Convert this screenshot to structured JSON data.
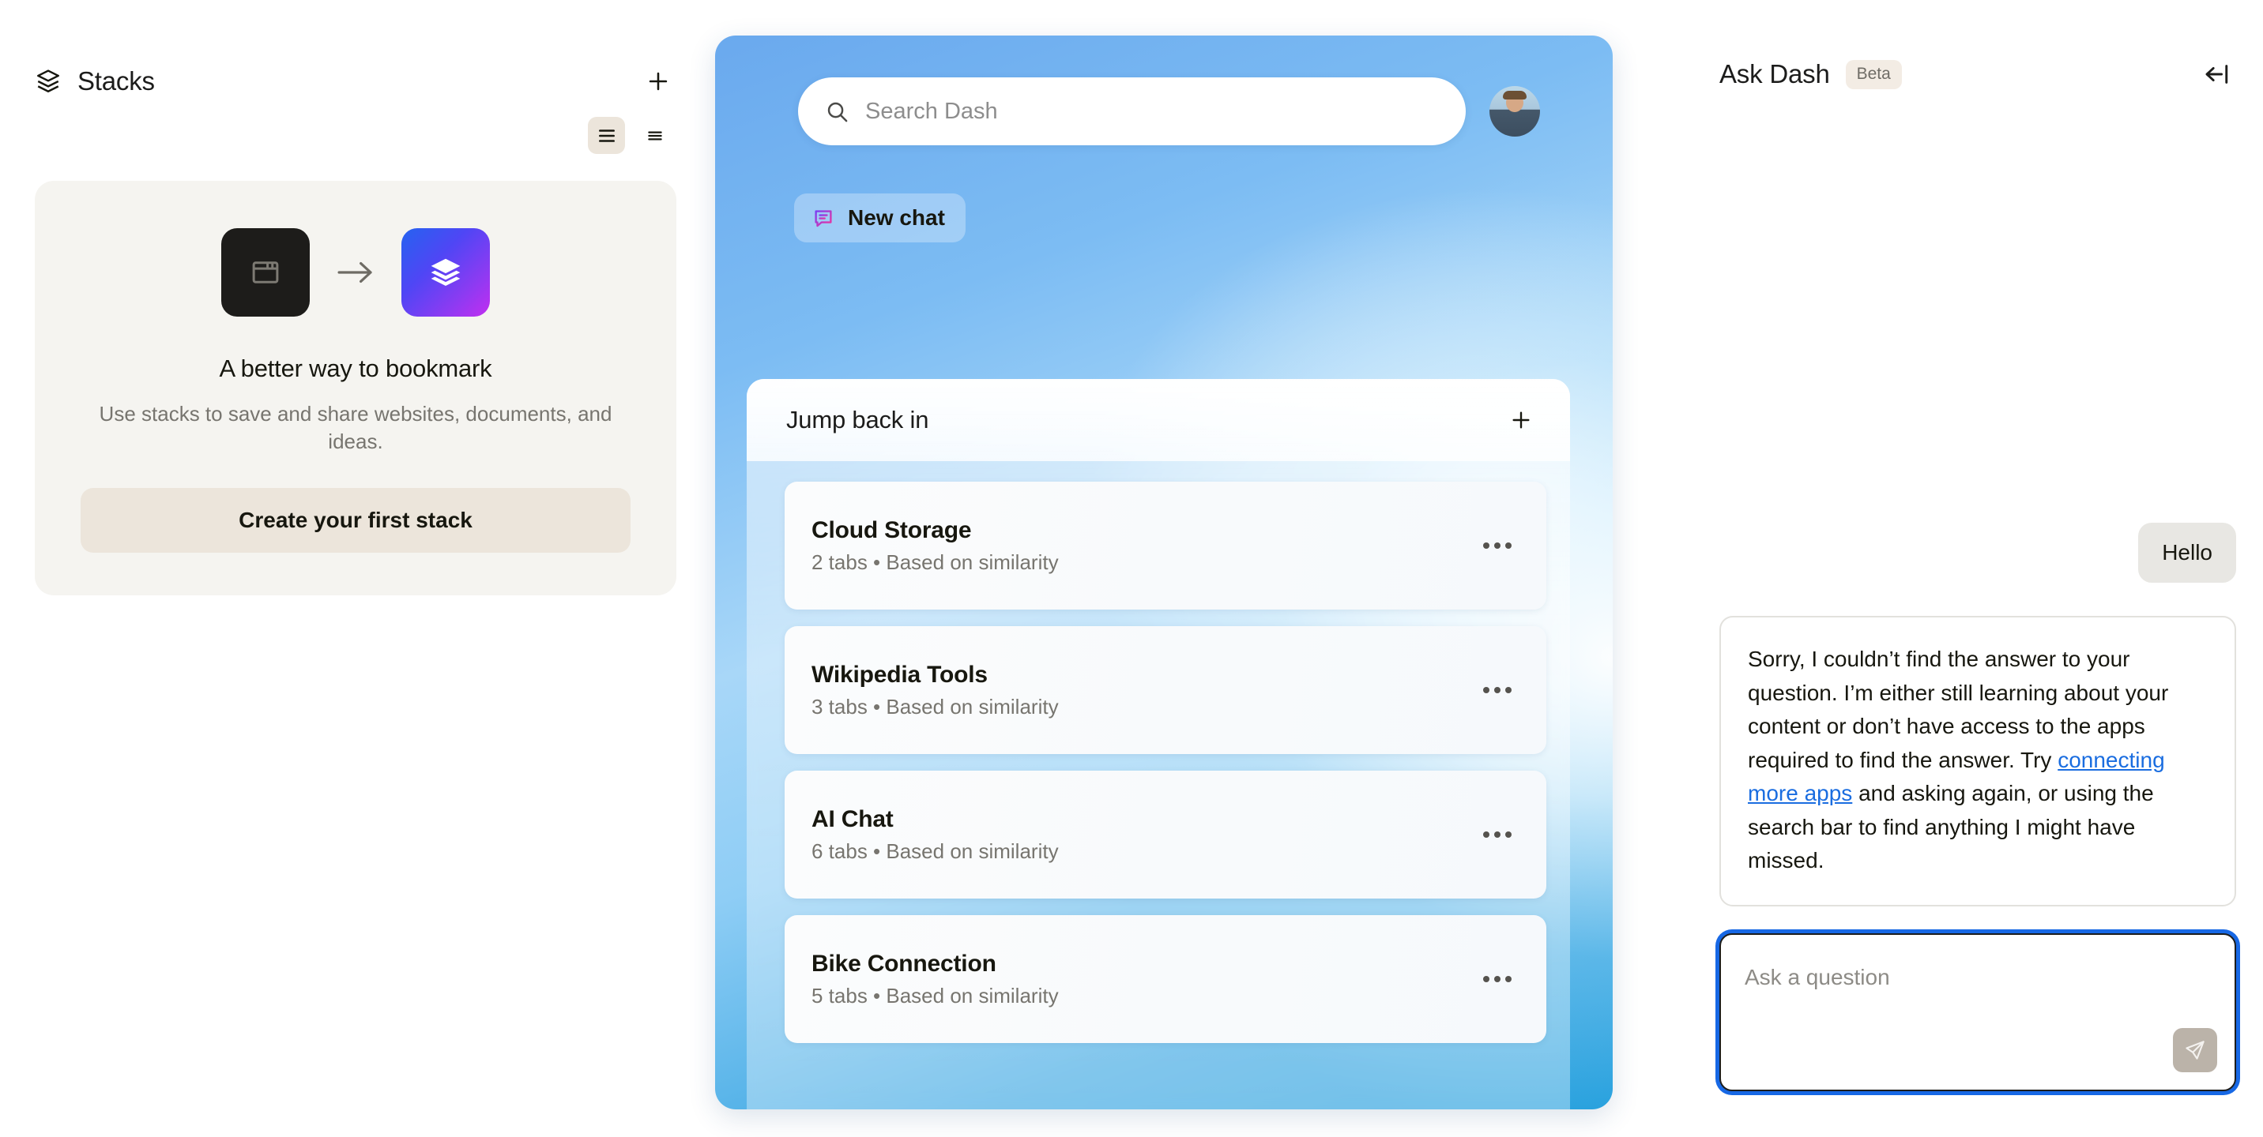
{
  "stacks": {
    "title": "Stacks",
    "icon": "layers-icon",
    "add_label": "+",
    "view_toggles": [
      {
        "name": "comfortable-view",
        "icon": "list-comfortable-icon",
        "active": true
      },
      {
        "name": "compact-view",
        "icon": "list-compact-icon",
        "active": false
      }
    ],
    "empty_state": {
      "from_icon": "browser-window-icon",
      "arrow_icon": "arrow-right-icon",
      "to_icon": "layers-gradient-icon",
      "title": "A better way to bookmark",
      "subtitle": "Use stacks to save and share websites, documents, and ideas.",
      "cta_label": "Create your first stack"
    }
  },
  "dash": {
    "search": {
      "icon": "search-icon",
      "placeholder": "Search Dash",
      "value": ""
    },
    "avatar": "user-avatar",
    "new_chat": {
      "icon": "chat-bubble-icon",
      "label": "New chat"
    },
    "jump_back_in": {
      "title": "Jump back in",
      "add_icon": "plus-icon",
      "items": [
        {
          "name": "Cloud Storage",
          "meta": "2 tabs • Based on similarity"
        },
        {
          "name": "Wikipedia Tools",
          "meta": "3 tabs • Based on similarity"
        },
        {
          "name": "AI Chat",
          "meta": "6 tabs • Based on similarity"
        },
        {
          "name": "Bike Connection",
          "meta": "5 tabs • Based on similarity"
        }
      ],
      "row_menu_icon": "ellipsis-icon"
    }
  },
  "ask_dash": {
    "title": "Ask Dash",
    "badge": "Beta",
    "collapse_icon": "collapse-panel-icon",
    "messages": {
      "user": "Hello",
      "bot_part1": "Sorry, I couldn’t find the answer to your question. I’m either still learning about your content or don’t have access to the apps required to find the answer. Try ",
      "bot_link": "connecting more apps",
      "bot_part2": " and asking again, or using the search bar to find anything I might have missed."
    },
    "composer": {
      "placeholder": "Ask a question",
      "value": "",
      "send_icon": "send-icon"
    }
  },
  "colors": {
    "accent_blue": "#1768e5",
    "link_blue": "#1a6de0",
    "beige": "#ece5db",
    "panel_blue": "#6aa9ee",
    "gradient_start": "#2563f0",
    "gradient_end": "#c22ef0"
  }
}
